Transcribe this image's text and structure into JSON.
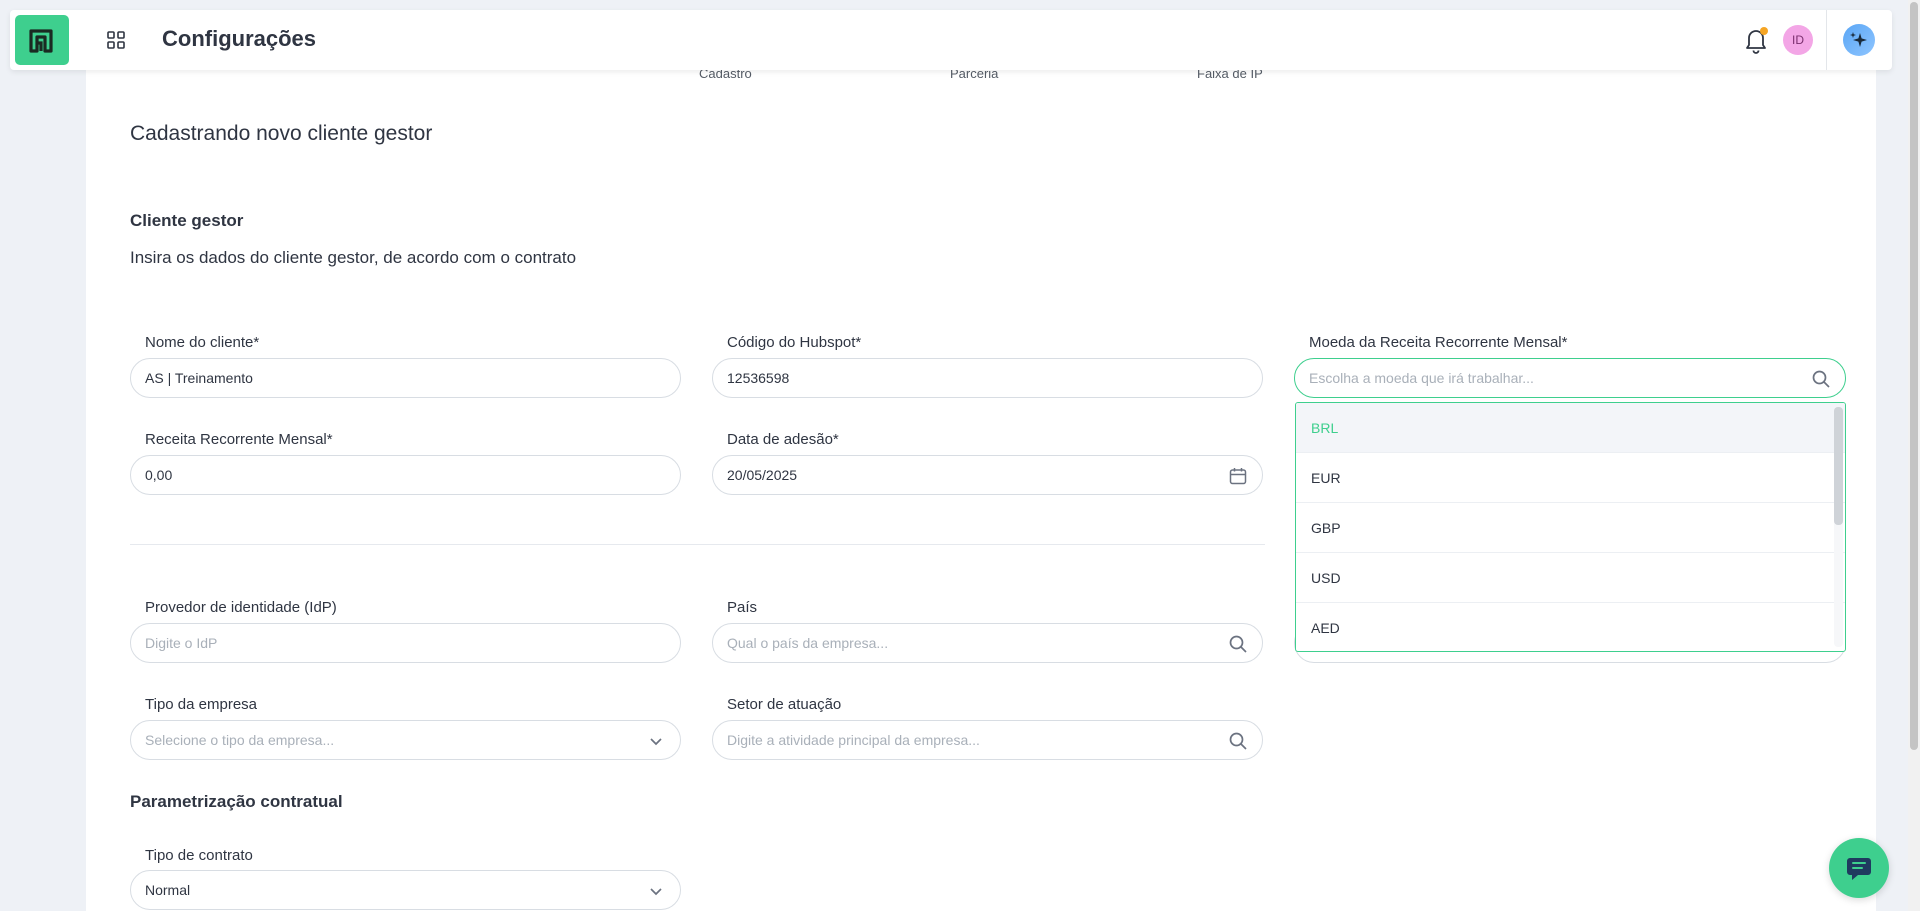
{
  "header": {
    "title": "Configurações",
    "avatar_initials": "ID"
  },
  "stepper": {
    "steps": [
      "Cadastro",
      "Parceria",
      "Faixa de IP"
    ]
  },
  "page": {
    "heading": "Cadastrando novo cliente gestor"
  },
  "section_client": {
    "title": "Cliente gestor",
    "description": "Insira os dados do cliente gestor, de acordo com o contrato"
  },
  "fields": {
    "client_name": {
      "label": "Nome do cliente*",
      "value": "AS | Treinamento"
    },
    "hubspot_code": {
      "label": "Código do Hubspot*",
      "value": "12536598"
    },
    "currency": {
      "label": "Moeda da Receita Recorrente Mensal*",
      "placeholder": "Escolha a moeda que irá trabalhar..."
    },
    "mrr": {
      "label": "Receita Recorrente Mensal*",
      "value": "0,00"
    },
    "join_date": {
      "label": "Data de adesão*",
      "value": "20/05/2025"
    },
    "idp": {
      "label": "Provedor de identidade (IdP)",
      "placeholder": "Digite o IdP"
    },
    "country": {
      "label": "País",
      "placeholder": "Qual o país da empresa..."
    },
    "company_type": {
      "label": "Tipo da empresa",
      "placeholder": "Selecione o tipo da empresa..."
    },
    "sector": {
      "label": "Setor de atuação",
      "placeholder": "Digite a atividade principal da empresa..."
    },
    "contract_type": {
      "label": "Tipo de contrato",
      "value": "Normal"
    }
  },
  "section_contract": {
    "title": "Parametrização contratual"
  },
  "currency_dropdown": {
    "options": [
      "BRL",
      "EUR",
      "GBP",
      "USD",
      "AED"
    ],
    "selected": "BRL"
  },
  "colors": {
    "accent": "#3ecf8e",
    "background": "#eef1f6",
    "text": "#2f3542",
    "notification": "#f5a524"
  },
  "icons": {
    "logo": "brand-logo-icon",
    "apps": "apps-grid-icon",
    "notifications": "bell-icon",
    "ai": "sparkles-icon",
    "search": "search-icon",
    "calendar": "calendar-icon",
    "chevron": "chevron-down-icon",
    "chat": "chat-bubble-icon"
  }
}
